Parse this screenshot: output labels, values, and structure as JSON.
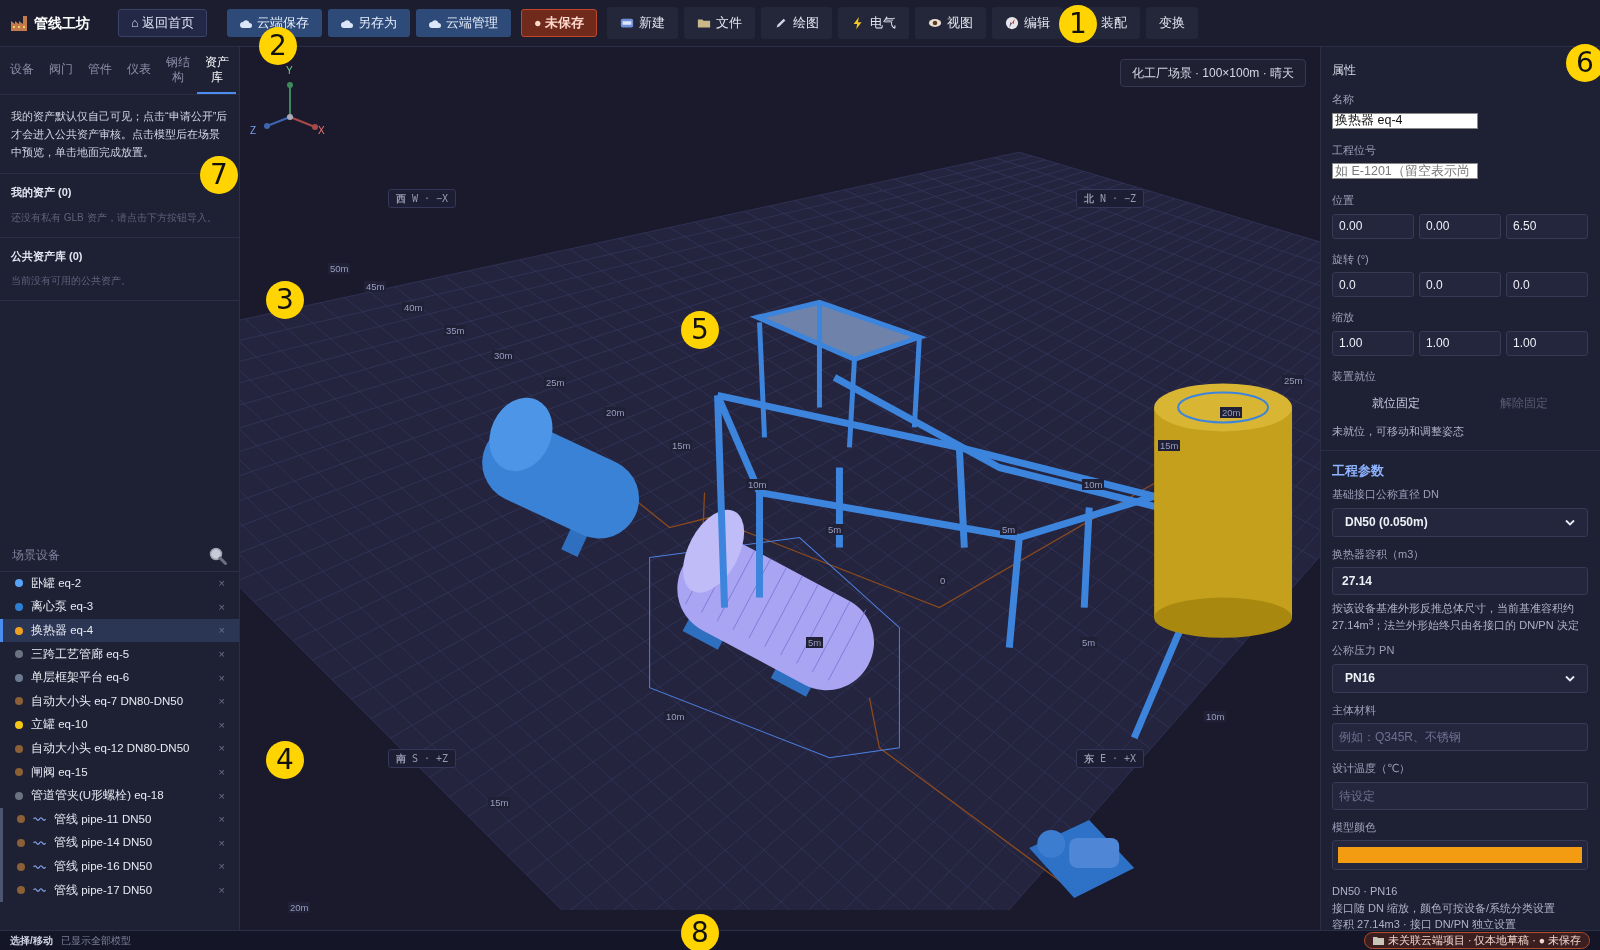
{
  "app": {
    "title": "管线工坊"
  },
  "toolbar": [
    {
      "kind": "home",
      "label": "⌂ 返回首页"
    },
    {
      "kind": "cloud",
      "label": "云端保存"
    },
    {
      "kind": "cloud",
      "label": "另存为"
    },
    {
      "kind": "cloud",
      "label": "云端管理"
    },
    {
      "kind": "unsaved",
      "label": "● 未保存"
    },
    {
      "kind": "menu",
      "label": "新建"
    },
    {
      "kind": "menu",
      "label": "文件"
    },
    {
      "kind": "menu",
      "label": "绘图"
    },
    {
      "kind": "menu",
      "label": "电气"
    },
    {
      "kind": "menu",
      "label": "视图"
    },
    {
      "kind": "menu",
      "label": "编辑"
    },
    {
      "kind": "menu",
      "label": "装配"
    },
    {
      "kind": "menu",
      "label": "变换"
    }
  ],
  "left_tabs": [
    {
      "label": "设备",
      "selected": false
    },
    {
      "label": "阀门",
      "selected": false
    },
    {
      "label": "管件",
      "selected": false
    },
    {
      "label": "仪表",
      "selected": false
    },
    {
      "label": "钢结构",
      "selected": false
    },
    {
      "label": "资产库",
      "selected": true
    }
  ],
  "asset_info": "我的资产默认仅自己可见；点击“申请公开”后才会进入公共资产审核。点击模型后在场景中预览，单击地面完成放置。",
  "asset_sections": [
    {
      "title": "我的资产 (0)",
      "empty_text": "还没有私有 GLB 资产，请点击下方按钮导入。"
    },
    {
      "title": "公共资产库 (0)",
      "empty_text": "当前没有可用的公共资产。"
    }
  ],
  "scene_devices": {
    "title": "场景设备",
    "items": [
      {
        "kind": "equipment",
        "label": "卧罐 eq-2",
        "color": "#5aa2f5",
        "selected": false,
        "remove": "×"
      },
      {
        "kind": "equipment",
        "label": "离心泵 eq-3",
        "color": "#2e7fd2",
        "selected": false,
        "remove": "×"
      },
      {
        "kind": "equipment",
        "label": "换热器 eq-4",
        "color": "#f0a020",
        "selected": true,
        "remove": "×"
      },
      {
        "kind": "equipment",
        "label": "三跨工艺管廊 eq-5",
        "color": "#6b7280",
        "selected": false,
        "remove": "×"
      },
      {
        "kind": "equipment",
        "label": "单层框架平台 eq-6",
        "color": "#6b7a90",
        "selected": false,
        "remove": "×"
      },
      {
        "kind": "equipment",
        "label": "自动大小头 eq-7 DN80-DN50",
        "color": "#8a6034",
        "selected": false,
        "remove": "×"
      },
      {
        "kind": "equipment",
        "label": "立罐 eq-10",
        "color": "#f5c518",
        "selected": false,
        "remove": "×"
      },
      {
        "kind": "equipment",
        "label": "自动大小头 eq-12 DN80-DN50",
        "color": "#8a6034",
        "selected": false,
        "remove": "×"
      },
      {
        "kind": "equipment",
        "label": "闸阀 eq-15",
        "color": "#8a6034",
        "selected": false,
        "remove": "×"
      },
      {
        "kind": "equipment",
        "label": "管道管夹(U形螺栓) eq-18",
        "color": "#6b7280",
        "selected": false,
        "remove": "×"
      },
      {
        "kind": "pipe",
        "label": "管线 pipe-11 DN50",
        "color": "#8a6034",
        "selected": false,
        "remove": "×"
      },
      {
        "kind": "pipe",
        "label": "管线 pipe-14 DN50",
        "color": "#8a6034",
        "selected": false,
        "remove": "×"
      },
      {
        "kind": "pipe",
        "label": "管线 pipe-16 DN50",
        "color": "#8a6034",
        "selected": false,
        "remove": "×"
      },
      {
        "kind": "pipe",
        "label": "管线 pipe-17 DN50",
        "color": "#8a6034",
        "selected": false,
        "remove": "×"
      }
    ]
  },
  "viewport": {
    "scene_info": "化工厂场景 · 100×100m · 晴天",
    "axis_labels": [
      "Y",
      "Z",
      "X"
    ],
    "compass": [
      "**西** W · −X",
      "**北** N · −Z",
      "**南** S · +Z",
      "**东** E · +X"
    ],
    "grid_labels": [
      "50m",
      "45m",
      "40m",
      "35m",
      "30m",
      "25m",
      "20m",
      "15m",
      "10m",
      "5m",
      "0",
      "25m",
      "20m",
      "15m",
      "10m",
      "5m",
      "5m",
      "5m",
      "10m",
      "10m",
      "15m",
      "20m"
    ]
  },
  "properties": {
    "title": "属性",
    "name": {
      "label": "名称",
      "value": "换热器 eq-4"
    },
    "tag": {
      "label": "工程位号",
      "placeholder": "如 E-1201（留空表示尚"
    },
    "transform": [
      {
        "label": "位置",
        "values": [
          "0.00",
          "0.00",
          "6.50"
        ]
      },
      {
        "label": "旋转 (°)",
        "values": [
          "0.0",
          "0.0",
          "0.0"
        ]
      },
      {
        "label": "缩放",
        "values": [
          "1.00",
          "1.00",
          "1.00"
        ]
      }
    ],
    "placement": {
      "label": "装置就位",
      "buttons": [
        {
          "label": "就位固定",
          "disabled": false
        },
        {
          "label": "解除固定",
          "disabled": true
        }
      ],
      "note": "未就位，可移动和调整姿态"
    }
  },
  "engineering": {
    "title": "工程参数",
    "fields": [
      {
        "kind": "select",
        "label": "基础接口公称直径 DN",
        "value": "DN50 (0.050m)"
      },
      {
        "kind": "input",
        "label": "换热器容积（m3）",
        "value": "27.14",
        "help": "按该设备基准外形反推总体尺寸，当前基准容积约27.14m$^{3}$；法兰外形始终只由各接口的 DN/PN 决定"
      },
      {
        "kind": "select",
        "label": "公称压力 PN",
        "value": "PN16"
      },
      {
        "kind": "input",
        "label": "主体材料",
        "placeholder": "例如：Q345R、不锈钢"
      },
      {
        "kind": "input",
        "label": "设计温度（℃）",
        "placeholder": "待设定"
      },
      {
        "kind": "color",
        "label": "模型颜色",
        "color": "#f39c12"
      }
    ],
    "summary": [
      "DN50 · PN16",
      "接口随 DN 缩放，颜色可按设备/系统分类设置",
      "容积 27.14m3 · 接口 DN/PN 独立设置"
    ]
  },
  "status_bar": {
    "mode": "选择/移动",
    "message": "已显示全部模型",
    "badge": "未关联云端项目 · 仅本地草稿 · ● 未保存"
  },
  "callouts": [
    "1",
    "2",
    "3",
    "4",
    "5",
    "6",
    "7",
    "8"
  ]
}
